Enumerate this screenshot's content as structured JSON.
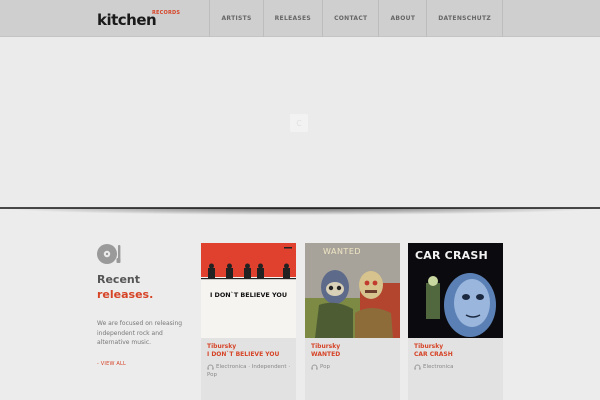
{
  "header": {
    "logo_word": "kitchen",
    "logo_sub": "RECORDS",
    "nav": [
      "ARTISTS",
      "RELEASES",
      "CONTACT",
      "ABOUT",
      "DATENSCHUTZ"
    ]
  },
  "hero": {
    "loader_glyph": "C"
  },
  "recent": {
    "heading_line1": "Recent",
    "heading_line2": "releases.",
    "description": "We are focused on releasing independent rock and alternative music.",
    "view_all": "- VIEW ALL"
  },
  "releases": [
    {
      "artist": "Tibursky",
      "title": "I DON`T BELIEVE YOU",
      "genre": "Electronica · Independent · Pop",
      "cover_text": "I DON`T BELIEVE YOU"
    },
    {
      "artist": "Tibursky",
      "title": "WANTED",
      "genre": "Pop",
      "cover_text": "WANTED"
    },
    {
      "artist": "Tibursky",
      "title": "CAR CRASH",
      "genre": "Electronica",
      "cover_text": "CAR CRASH"
    }
  ],
  "colors": {
    "accent": "#d64427",
    "topbar": "#cfcfcf",
    "background": "#ececec"
  },
  "icons": {
    "vinyl": "record-player-icon",
    "genre": "headphones-icon"
  }
}
